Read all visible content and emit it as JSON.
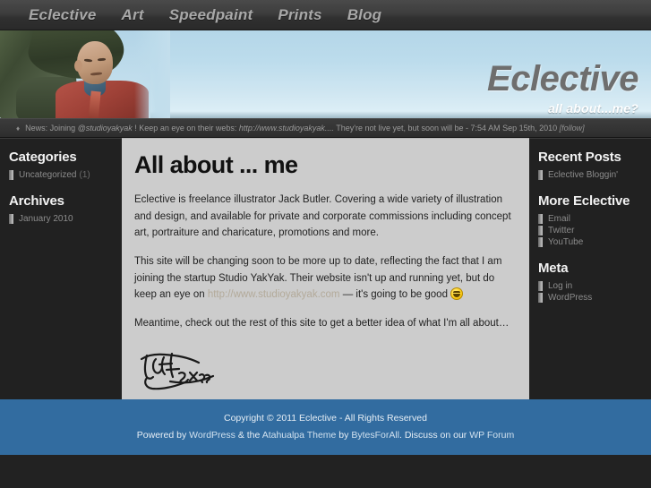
{
  "nav": {
    "items": [
      {
        "label": "Eclective"
      },
      {
        "label": "Art"
      },
      {
        "label": "Speedpaint"
      },
      {
        "label": "Prints"
      },
      {
        "label": "Blog"
      }
    ]
  },
  "header": {
    "site_title": "Eclective",
    "tagline": "all about...me?",
    "banner_art_alt": "illustration of a young monk under a tree"
  },
  "ticker": {
    "bullet": "♦",
    "prefix": "News: Joining ",
    "handle": "@studioyakyak",
    "middle": " ! Keep an eye on their webs: ",
    "url": "http://www.studioyakyak....",
    "suffix": " They're not live yet, but soon will be - 7:54 AM Sep 15th, 2010 ",
    "follow": "[follow]",
    "full_text": "News: Joining @studioyakyak ! Keep an eye on their webs: http://www.studioyakyak.... They're not live yet, but soon will be - 7:54 AM Sep 15th, 2010 [follow]"
  },
  "sidebar_left": {
    "widgets": [
      {
        "title": "Categories",
        "items": [
          {
            "label": "Uncategorized",
            "count": "(1)"
          }
        ]
      },
      {
        "title": "Archives",
        "items": [
          {
            "label": "January 2010",
            "count": ""
          }
        ]
      }
    ]
  },
  "sidebar_right": {
    "widgets": [
      {
        "title": "Recent Posts",
        "items": [
          {
            "label": "Eclective Bloggin'",
            "count": ""
          }
        ]
      },
      {
        "title": "More Eclective",
        "items": [
          {
            "label": "Email",
            "count": ""
          },
          {
            "label": "Twitter",
            "count": ""
          },
          {
            "label": "YouTube",
            "count": ""
          }
        ]
      },
      {
        "title": "Meta",
        "items": [
          {
            "label": "Log in",
            "count": ""
          },
          {
            "label": "WordPress",
            "count": ""
          }
        ]
      }
    ]
  },
  "content": {
    "title": "All about ... me",
    "paragraph_1": "Eclective is freelance illustrator Jack Butler. Covering a wide variety of illustration and design, and available for private and corporate commissions including concept art, portraiture and charicature, promotions and more.",
    "paragraph_2_before_link": "This site will be changing soon to be more up to date, reflecting the fact that I am joining the startup Studio YakYak.  Their website isn't up and running yet, but do keep an eye on ",
    "paragraph_2_link": "http://www.studioyakyak.com",
    "paragraph_2_after_link": " — it's going to be good",
    "paragraph_3": "Meantime, check out the rest of this site to get a better idea of what I'm all about…",
    "signature_alt": "handwritten signature Jack 2x10"
  },
  "footer": {
    "copyright": "Copyright © 2011 Eclective - All Rights Reserved",
    "credits_part_1": "Powered by ",
    "credits_link_1": "WordPress",
    "credits_part_2": " & the ",
    "credits_link_2": "Atahualpa Theme",
    "credits_part_3": " by ",
    "credits_link_3": "BytesForAll",
    "credits_part_4": ". Discuss on our ",
    "credits_link_4": "WP Forum",
    "credits_full": "Powered by WordPress & the Atahualpa Theme by BytesForAll. Discuss on our WP Forum"
  },
  "colors": {
    "nav_bg": "#3d3d3d",
    "header_sky": "#c2dfee",
    "sidebar_bg": "#212121",
    "content_bg": "#cccccc",
    "footer_blue": "#326ca0",
    "link_tan": "#b3aa9a",
    "page_bg": "#222222"
  }
}
